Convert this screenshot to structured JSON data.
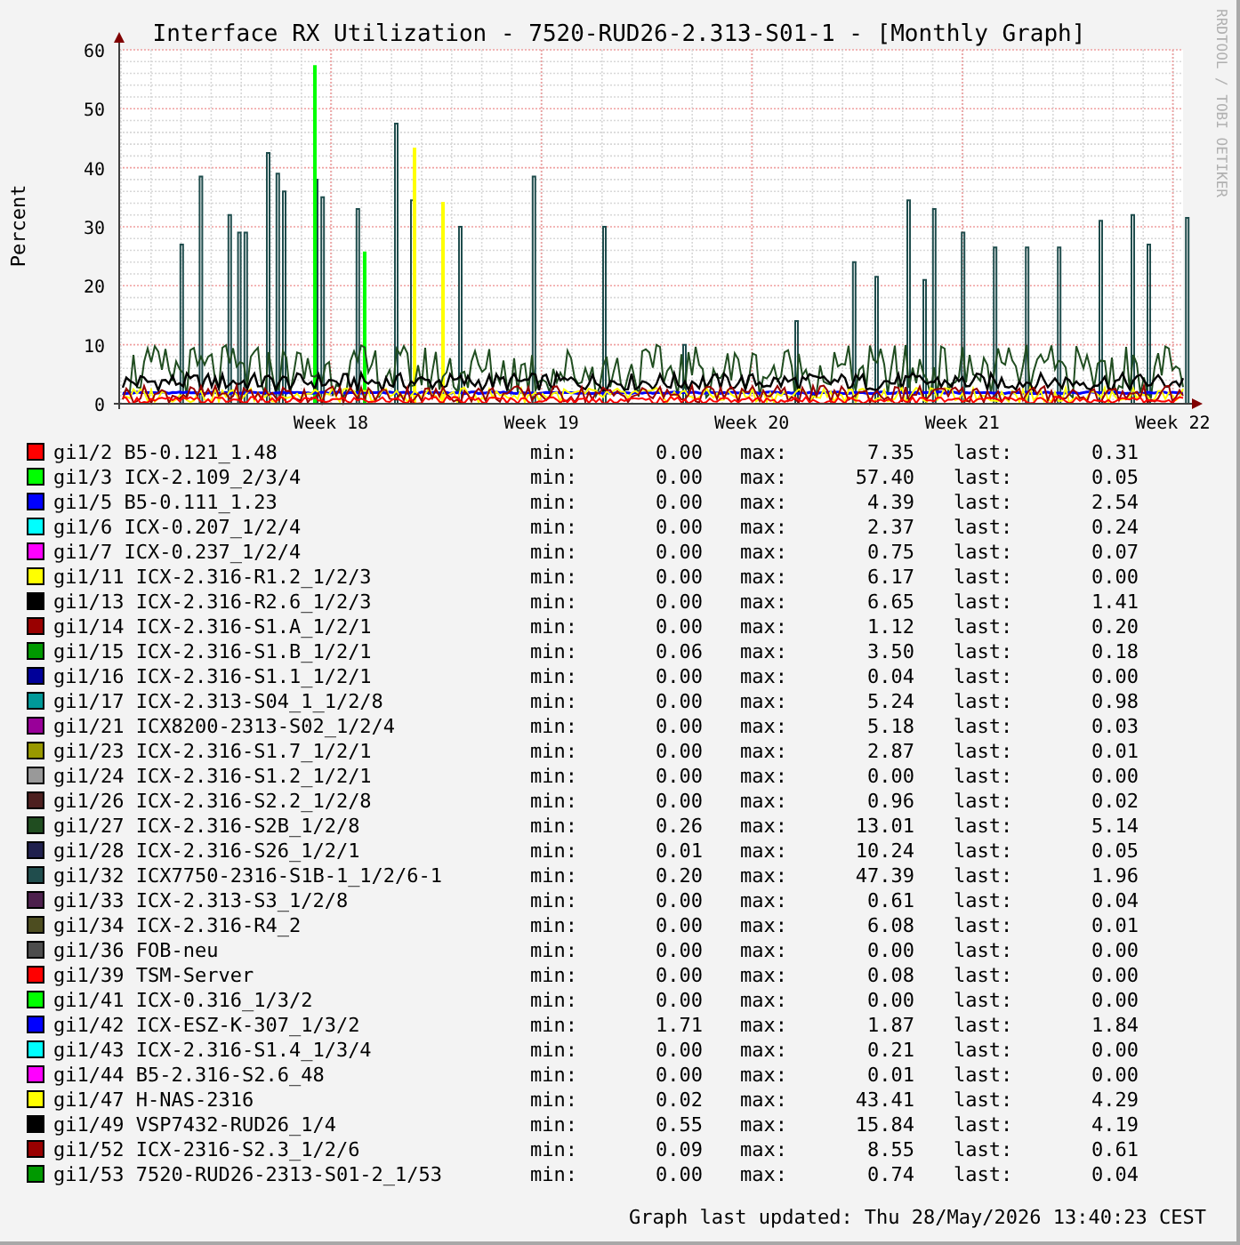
{
  "graph": {
    "title": "Interface RX Utilization - 7520-RUD26-2.313-S01-1 - [Monthly Graph]",
    "ylabel": "Percent",
    "signature": "RRDTOOL / TOBI OETIKER",
    "yticks": [
      "60",
      "50",
      "40",
      "30",
      "20",
      "10",
      "0"
    ],
    "xticks": [
      "Week 18",
      "Week 19",
      "Week 20",
      "Week 21",
      "Week 22"
    ]
  },
  "legend": [
    {
      "label": "gi1/2 B5-0.121_1.48",
      "color": "#ff0000",
      "min_label": "min:",
      "min": "0.00",
      "max_label": "max:",
      "max": "7.35",
      "last_label": "last:",
      "last": "0.31"
    },
    {
      "label": "gi1/3 ICX-2.109_2/3/4",
      "color": "#00ff00",
      "min_label": "min:",
      "min": "0.00",
      "max_label": "max:",
      "max": "57.40",
      "last_label": "last:",
      "last": "0.05"
    },
    {
      "label": "gi1/5 B5-0.111_1.23",
      "color": "#0000ff",
      "min_label": "min:",
      "min": "0.00",
      "max_label": "max:",
      "max": "4.39",
      "last_label": "last:",
      "last": "2.54"
    },
    {
      "label": "gi1/6 ICX-0.207_1/2/4",
      "color": "#00ffff",
      "min_label": "min:",
      "min": "0.00",
      "max_label": "max:",
      "max": "2.37",
      "last_label": "last:",
      "last": "0.24"
    },
    {
      "label": "gi1/7 ICX-0.237_1/2/4",
      "color": "#ff00ff",
      "min_label": "min:",
      "min": "0.00",
      "max_label": "max:",
      "max": "0.75",
      "last_label": "last:",
      "last": "0.07"
    },
    {
      "label": "gi1/11 ICX-2.316-R1.2_1/2/3",
      "color": "#ffff00",
      "min_label": "min:",
      "min": "0.00",
      "max_label": "max:",
      "max": "6.17",
      "last_label": "last:",
      "last": "0.00"
    },
    {
      "label": "gi1/13 ICX-2.316-R2.6_1/2/3",
      "color": "#000000",
      "min_label": "min:",
      "min": "0.00",
      "max_label": "max:",
      "max": "6.65",
      "last_label": "last:",
      "last": "1.41"
    },
    {
      "label": "gi1/14 ICX-2.316-S1.A_1/2/1",
      "color": "#990000",
      "min_label": "min:",
      "min": "0.00",
      "max_label": "max:",
      "max": "1.12",
      "last_label": "last:",
      "last": "0.20"
    },
    {
      "label": "gi1/15 ICX-2.316-S1.B_1/2/1",
      "color": "#009900",
      "min_label": "min:",
      "min": "0.06",
      "max_label": "max:",
      "max": "3.50",
      "last_label": "last:",
      "last": "0.18"
    },
    {
      "label": "gi1/16 ICX-2.316-S1.1_1/2/1",
      "color": "#000099",
      "min_label": "min:",
      "min": "0.00",
      "max_label": "max:",
      "max": "0.04",
      "last_label": "last:",
      "last": "0.00"
    },
    {
      "label": "gi1/17 ICX-2.313-S04_1_1/2/8",
      "color": "#009999",
      "min_label": "min:",
      "min": "0.00",
      "max_label": "max:",
      "max": "5.24",
      "last_label": "last:",
      "last": "0.98"
    },
    {
      "label": "gi1/21 ICX8200-2313-S02_1/2/4",
      "color": "#990099",
      "min_label": "min:",
      "min": "0.00",
      "max_label": "max:",
      "max": "5.18",
      "last_label": "last:",
      "last": "0.03"
    },
    {
      "label": "gi1/23 ICX-2.316-S1.7_1/2/1",
      "color": "#999900",
      "min_label": "min:",
      "min": "0.00",
      "max_label": "max:",
      "max": "2.87",
      "last_label": "last:",
      "last": "0.01"
    },
    {
      "label": "gi1/24 ICX-2.316-S1.2_1/2/1",
      "color": "#999999",
      "min_label": "min:",
      "min": "0.00",
      "max_label": "max:",
      "max": "0.00",
      "last_label": "last:",
      "last": "0.00"
    },
    {
      "label": "gi1/26 ICX-2.316-S2.2_1/2/8",
      "color": "#4d2020",
      "min_label": "min:",
      "min": "0.00",
      "max_label": "max:",
      "max": "0.96",
      "last_label": "last:",
      "last": "0.02"
    },
    {
      "label": "gi1/27 ICX-2.316-S2B_1/2/8",
      "color": "#204d20",
      "min_label": "min:",
      "min": "0.26",
      "max_label": "max:",
      "max": "13.01",
      "last_label": "last:",
      "last": "5.14"
    },
    {
      "label": "gi1/28 ICX-2.316-S26_1/2/1",
      "color": "#20204d",
      "min_label": "min:",
      "min": "0.01",
      "max_label": "max:",
      "max": "10.24",
      "last_label": "last:",
      "last": "0.05"
    },
    {
      "label": "gi1/32 ICX7750-2316-S1B-1_1/2/6-1",
      "color": "#204d4d",
      "min_label": "min:",
      "min": "0.20",
      "max_label": "max:",
      "max": "47.39",
      "last_label": "last:",
      "last": "1.96"
    },
    {
      "label": "gi1/33 ICX-2.313-S3_1/2/8",
      "color": "#4d204d",
      "min_label": "min:",
      "min": "0.00",
      "max_label": "max:",
      "max": "0.61",
      "last_label": "last:",
      "last": "0.04"
    },
    {
      "label": "gi1/34 ICX-2.316-R4_2",
      "color": "#4d4d20",
      "min_label": "min:",
      "min": "0.00",
      "max_label": "max:",
      "max": "6.08",
      "last_label": "last:",
      "last": "0.01"
    },
    {
      "label": "gi1/36 FOB-neu",
      "color": "#4d4d4d",
      "min_label": "min:",
      "min": "0.00",
      "max_label": "max:",
      "max": "0.00",
      "last_label": "last:",
      "last": "0.00"
    },
    {
      "label": "gi1/39 TSM-Server",
      "color": "#ff0000",
      "min_label": "min:",
      "min": "0.00",
      "max_label": "max:",
      "max": "0.08",
      "last_label": "last:",
      "last": "0.00"
    },
    {
      "label": "gi1/41 ICX-0.316_1/3/2",
      "color": "#00ff00",
      "min_label": "min:",
      "min": "0.00",
      "max_label": "max:",
      "max": "0.00",
      "last_label": "last:",
      "last": "0.00"
    },
    {
      "label": "gi1/42 ICX-ESZ-K-307_1/3/2",
      "color": "#0000ff",
      "min_label": "min:",
      "min": "1.71",
      "max_label": "max:",
      "max": "1.87",
      "last_label": "last:",
      "last": "1.84"
    },
    {
      "label": "gi1/43 ICX-2.316-S1.4_1/3/4",
      "color": "#00ffff",
      "min_label": "min:",
      "min": "0.00",
      "max_label": "max:",
      "max": "0.21",
      "last_label": "last:",
      "last": "0.00"
    },
    {
      "label": "gi1/44 B5-2.316-S2.6_48",
      "color": "#ff00ff",
      "min_label": "min:",
      "min": "0.00",
      "max_label": "max:",
      "max": "0.01",
      "last_label": "last:",
      "last": "0.00"
    },
    {
      "label": "gi1/47 H-NAS-2316",
      "color": "#ffff00",
      "min_label": "min:",
      "min": "0.02",
      "max_label": "max:",
      "max": "43.41",
      "last_label": "last:",
      "last": "4.29"
    },
    {
      "label": "gi1/49 VSP7432-RUD26_1/4",
      "color": "#000000",
      "min_label": "min:",
      "min": "0.55",
      "max_label": "max:",
      "max": "15.84",
      "last_label": "last:",
      "last": "4.19"
    },
    {
      "label": "gi1/52 ICX-2316-S2.3_1/2/6",
      "color": "#990000",
      "min_label": "min:",
      "min": "0.09",
      "max_label": "max:",
      "max": "8.55",
      "last_label": "last:",
      "last": "0.61"
    },
    {
      "label": "gi1/53 7520-RUD26-2313-S01-2_1/53",
      "color": "#009900",
      "min_label": "min:",
      "min": "0.00",
      "max_label": "max:",
      "max": "0.74",
      "last_label": "last:",
      "last": "0.04"
    }
  ],
  "footer": "Graph last updated: Thu 28/May/2026 13:40:23 CEST"
}
